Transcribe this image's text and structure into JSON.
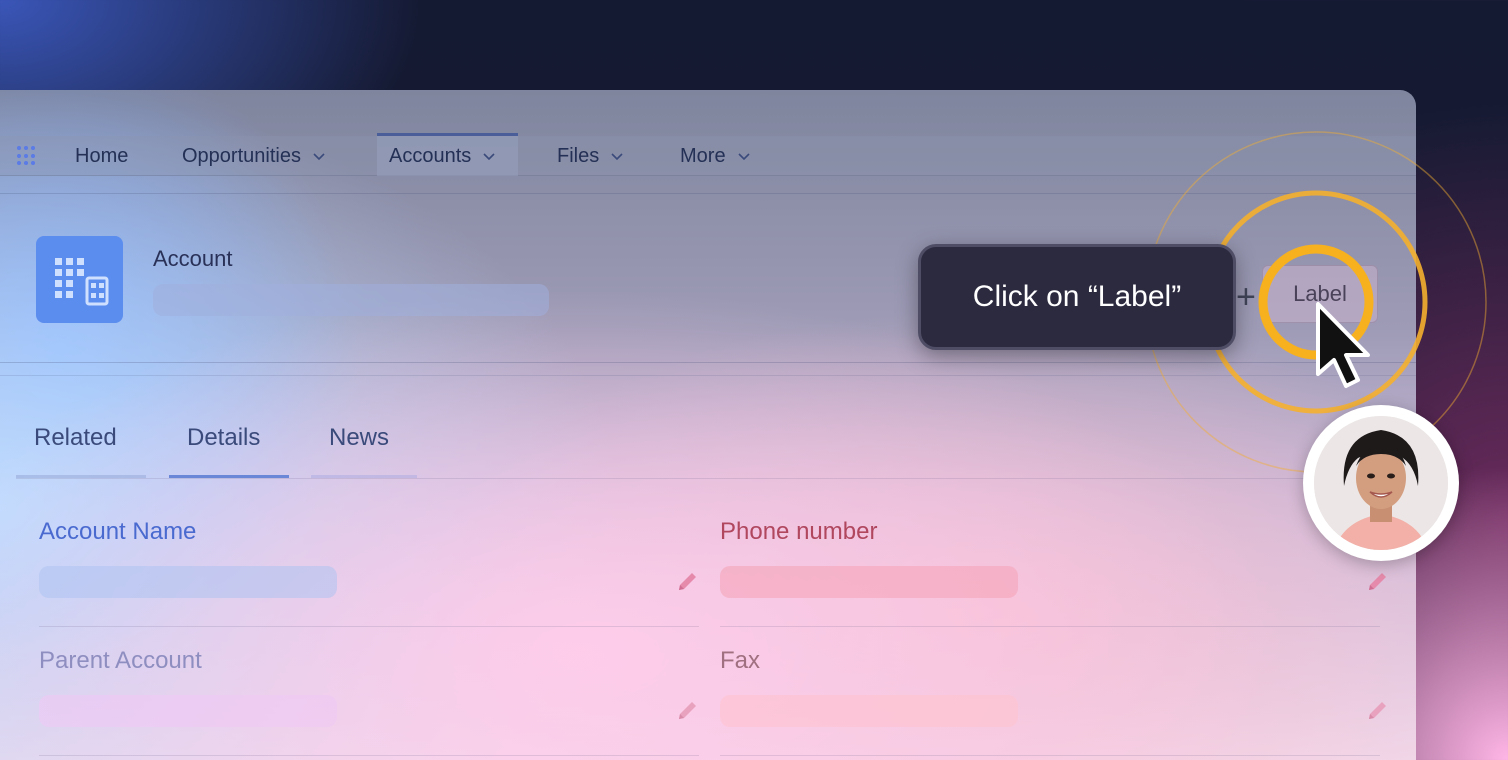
{
  "nav": {
    "items": [
      {
        "label": "Home",
        "has_chevron": false
      },
      {
        "label": "Opportunities",
        "has_chevron": true
      },
      {
        "label": "Accounts",
        "has_chevron": true,
        "active": true
      },
      {
        "label": "Files",
        "has_chevron": true
      },
      {
        "label": "More",
        "has_chevron": true
      }
    ]
  },
  "header": {
    "object_label": "Account",
    "icon": "building-icon"
  },
  "tabs": [
    {
      "label": "Related",
      "active": false
    },
    {
      "label": "Details",
      "active": true
    },
    {
      "label": "News",
      "active": false
    }
  ],
  "fields": {
    "account_name": "Account Name",
    "parent_account": "Parent Account",
    "phone_number": "Phone number",
    "fax": "Fax"
  },
  "tooltip": {
    "text": "Click on “Label”"
  },
  "action": {
    "plus": "+",
    "label_button": "Label"
  },
  "colors": {
    "accent_blue": "#5b8def",
    "field_label_blue": "#4a6ad0",
    "field_label_red": "#b0475f",
    "highlight_ring": "#f5b02e",
    "tooltip_bg": "#2b2a3f"
  }
}
